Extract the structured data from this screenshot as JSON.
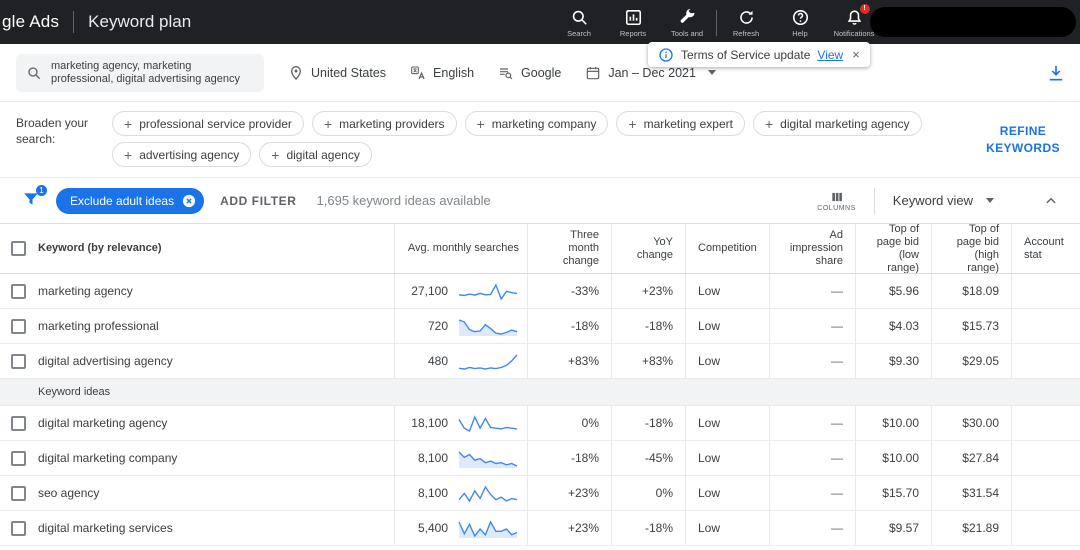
{
  "header": {
    "brand": "gle Ads",
    "title": "Keyword plan",
    "nav_items": [
      {
        "id": "search",
        "label": "Search"
      },
      {
        "id": "reports",
        "label": "Reports"
      },
      {
        "id": "tools",
        "label": "Tools and"
      },
      {
        "id": "refresh",
        "label": "Refresh"
      },
      {
        "id": "help",
        "label": "Help"
      },
      {
        "id": "notifications",
        "label": "Notifications",
        "badge": "!"
      }
    ]
  },
  "tos_banner": {
    "text": "Terms of Service update",
    "link_label": "View",
    "close_label": "×"
  },
  "plan_settings": {
    "keywords": "marketing agency, marketing professional, digital advertising agency",
    "location": "United States",
    "language": "English",
    "network": "Google",
    "date_range": "Jan – Dec 2021"
  },
  "broaden": {
    "label": "Broaden your search:",
    "chips": [
      "professional service provider",
      "marketing providers",
      "marketing company",
      "marketing expert",
      "digital marketing agency",
      "advertising agency",
      "digital agency"
    ],
    "refine_label": "REFINE KEYWORDS"
  },
  "filter_bar": {
    "filter_badge": "1",
    "exclude_chip": "Exclude adult ideas",
    "add_filter_label": "ADD FILTER",
    "ideas_count": "1,695 keyword ideas available",
    "columns_label": "COLUMNS",
    "view_label": "Keyword view"
  },
  "table": {
    "headers": [
      "Keyword (by relevance)",
      "Avg. monthly searches",
      "Three month change",
      "YoY change",
      "Competition",
      "Ad impression share",
      "Top of page bid (low range)",
      "Top of page bid (high range)",
      "Account stat"
    ],
    "section_label": "Keyword ideas",
    "provided_keywords": [
      {
        "keyword": "marketing agency",
        "avg_monthly_searches": "27,100",
        "trend": [
          34,
          32,
          36,
          33,
          38,
          34,
          35,
          62,
          22,
          44,
          40,
          38
        ],
        "trend_fill": false,
        "three_month_change": "-33%",
        "yoy_change": "+23%",
        "competition": "Low",
        "ad_impression_share": "—",
        "top_of_page_bid_low": "$5.96",
        "top_of_page_bid_high": "$18.09"
      },
      {
        "keyword": "marketing professional",
        "avg_monthly_searches": "720",
        "trend": [
          60,
          55,
          35,
          30,
          32,
          48,
          38,
          26,
          24,
          28,
          34,
          30
        ],
        "trend_fill": true,
        "three_month_change": "-18%",
        "yoy_change": "-18%",
        "competition": "Low",
        "ad_impression_share": "—",
        "top_of_page_bid_low": "$4.03",
        "top_of_page_bid_high": "$15.73"
      },
      {
        "keyword": "digital advertising agency",
        "avg_monthly_searches": "480",
        "trend": [
          26,
          24,
          28,
          25,
          27,
          24,
          27,
          25,
          28,
          34,
          46,
          62
        ],
        "trend_fill": false,
        "three_month_change": "+83%",
        "yoy_change": "+83%",
        "competition": "Low",
        "ad_impression_share": "—",
        "top_of_page_bid_low": "$9.30",
        "top_of_page_bid_high": "$29.05"
      }
    ],
    "keyword_ideas": [
      {
        "keyword": "digital marketing agency",
        "avg_monthly_searches": "18,100",
        "trend": [
          55,
          30,
          22,
          62,
          30,
          58,
          32,
          30,
          28,
          32,
          30,
          28
        ],
        "trend_fill": false,
        "three_month_change": "0%",
        "yoy_change": "-18%",
        "competition": "Low",
        "ad_impression_share": "—",
        "top_of_page_bid_low": "$10.00",
        "top_of_page_bid_high": "$30.00"
      },
      {
        "keyword": "digital marketing company",
        "avg_monthly_searches": "8,100",
        "trend": [
          58,
          45,
          52,
          38,
          42,
          32,
          36,
          30,
          32,
          27,
          30,
          24
        ],
        "trend_fill": true,
        "three_month_change": "-18%",
        "yoy_change": "-45%",
        "competition": "Low",
        "ad_impression_share": "—",
        "top_of_page_bid_low": "$10.00",
        "top_of_page_bid_high": "$27.84"
      },
      {
        "keyword": "seo agency",
        "avg_monthly_searches": "8,100",
        "trend": [
          32,
          42,
          30,
          46,
          34,
          52,
          40,
          32,
          36,
          30,
          34,
          32
        ],
        "trend_fill": false,
        "three_month_change": "+23%",
        "yoy_change": "0%",
        "competition": "Low",
        "ad_impression_share": "—",
        "top_of_page_bid_low": "$15.70",
        "top_of_page_bid_high": "$31.54"
      },
      {
        "keyword": "digital marketing services",
        "avg_monthly_searches": "5,400",
        "trend": [
          42,
          32,
          40,
          30,
          36,
          31,
          42,
          34,
          34,
          36,
          31,
          33
        ],
        "trend_fill": true,
        "three_month_change": "+23%",
        "yoy_change": "-18%",
        "competition": "Low",
        "ad_impression_share": "—",
        "top_of_page_bid_low": "$9.57",
        "top_of_page_bid_high": "$21.89"
      }
    ]
  },
  "colors": {
    "accent": "#1a73e8",
    "sparkline": "#4285f4",
    "badge_red": "#d93025",
    "topbar_bg": "#202124"
  }
}
